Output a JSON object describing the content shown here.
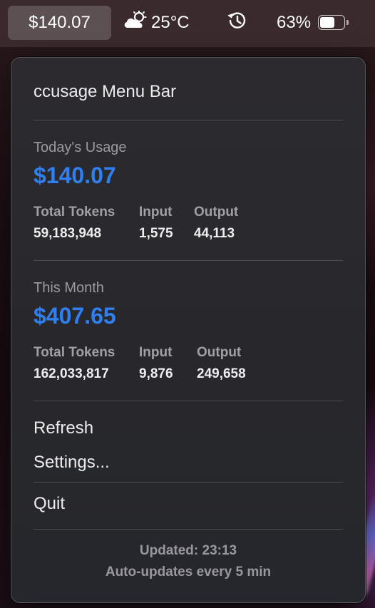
{
  "menubar": {
    "price": "$140.07",
    "temperature": "25°C",
    "weather_icon": "cloud-sun-icon",
    "clock_icon": "time-machine-icon",
    "battery_percent": "63%",
    "battery_level": 0.63
  },
  "panel": {
    "title": "ccusage Menu Bar",
    "today": {
      "label": "Today's Usage",
      "amount": "$140.07",
      "headers": {
        "total": "Total Tokens",
        "input": "Input",
        "output": "Output"
      },
      "values": {
        "total": "59,183,948",
        "input": "1,575",
        "output": "44,113"
      }
    },
    "month": {
      "label": "This Month",
      "amount": "$407.65",
      "headers": {
        "total": "Total Tokens",
        "input": "Input",
        "output": "Output"
      },
      "values": {
        "total": "162,033,817",
        "input": "9,876",
        "output": "249,658"
      }
    },
    "menu": {
      "refresh": "Refresh",
      "settings": "Settings...",
      "quit": "Quit"
    },
    "footer": {
      "updated": "Updated: 23:13",
      "auto": "Auto-updates every 5 min"
    }
  },
  "colors": {
    "accent": "#2f7ff0",
    "panel_bg": "#2a292d",
    "text": "#ececef",
    "muted": "#9b9ba0"
  }
}
